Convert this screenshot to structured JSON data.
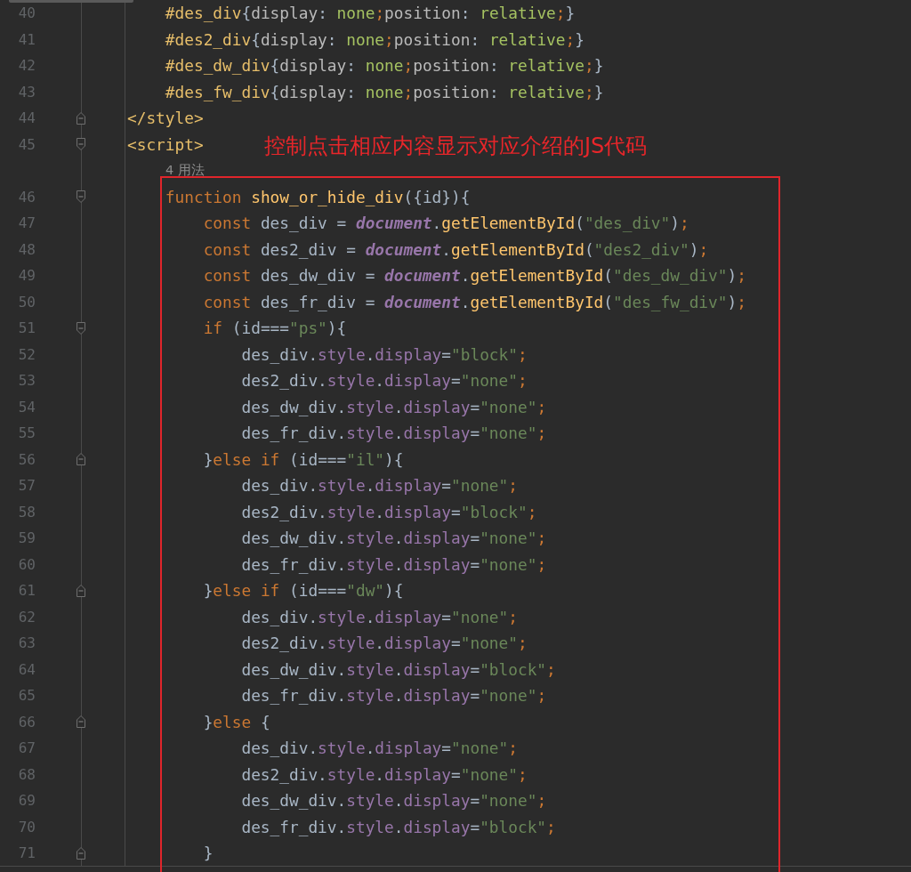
{
  "editor": {
    "lines": [
      {
        "kind": "code",
        "number": "40",
        "fold_open": false,
        "fold_close": false,
        "tokens": [
          {
            "kind": "selector",
            "text": "    #des_div"
          },
          {
            "kind": "plain",
            "text": "{"
          },
          {
            "kind": "css-property",
            "text": "display"
          },
          {
            "kind": "plain",
            "text": ": "
          },
          {
            "kind": "css-value",
            "text": "none"
          },
          {
            "kind": "punctuation",
            "text": ";"
          },
          {
            "kind": "css-property",
            "text": "position"
          },
          {
            "kind": "plain",
            "text": ": "
          },
          {
            "kind": "css-value",
            "text": "relative"
          },
          {
            "kind": "punctuation",
            "text": ";"
          },
          {
            "kind": "plain",
            "text": "}"
          }
        ]
      },
      {
        "kind": "code",
        "number": "41",
        "fold_open": false,
        "fold_close": false,
        "tokens": [
          {
            "kind": "selector",
            "text": "    #des2_div"
          },
          {
            "kind": "plain",
            "text": "{"
          },
          {
            "kind": "css-property",
            "text": "display"
          },
          {
            "kind": "plain",
            "text": ": "
          },
          {
            "kind": "css-value",
            "text": "none"
          },
          {
            "kind": "punctuation",
            "text": ";"
          },
          {
            "kind": "css-property",
            "text": "position"
          },
          {
            "kind": "plain",
            "text": ": "
          },
          {
            "kind": "css-value",
            "text": "relative"
          },
          {
            "kind": "punctuation",
            "text": ";"
          },
          {
            "kind": "plain",
            "text": "}"
          }
        ]
      },
      {
        "kind": "code",
        "number": "42",
        "fold_open": false,
        "fold_close": false,
        "tokens": [
          {
            "kind": "selector",
            "text": "    #des_dw_div"
          },
          {
            "kind": "plain",
            "text": "{"
          },
          {
            "kind": "css-property",
            "text": "display"
          },
          {
            "kind": "plain",
            "text": ": "
          },
          {
            "kind": "css-value",
            "text": "none"
          },
          {
            "kind": "punctuation",
            "text": ";"
          },
          {
            "kind": "css-property",
            "text": "position"
          },
          {
            "kind": "plain",
            "text": ": "
          },
          {
            "kind": "css-value",
            "text": "relative"
          },
          {
            "kind": "punctuation",
            "text": ";"
          },
          {
            "kind": "plain",
            "text": "}"
          }
        ]
      },
      {
        "kind": "code",
        "number": "43",
        "fold_open": false,
        "fold_close": false,
        "tokens": [
          {
            "kind": "selector",
            "text": "    #des_fw_div"
          },
          {
            "kind": "plain",
            "text": "{"
          },
          {
            "kind": "css-property",
            "text": "display"
          },
          {
            "kind": "plain",
            "text": ": "
          },
          {
            "kind": "css-value",
            "text": "none"
          },
          {
            "kind": "punctuation",
            "text": ";"
          },
          {
            "kind": "css-property",
            "text": "position"
          },
          {
            "kind": "plain",
            "text": ": "
          },
          {
            "kind": "css-value",
            "text": "relative"
          },
          {
            "kind": "punctuation",
            "text": ";"
          },
          {
            "kind": "plain",
            "text": "}"
          }
        ]
      },
      {
        "kind": "code",
        "number": "44",
        "fold_open": false,
        "fold_close": true,
        "tokens": [
          {
            "kind": "tag",
            "text": "</style>"
          }
        ]
      },
      {
        "kind": "code",
        "number": "45",
        "fold_open": true,
        "fold_close": false,
        "tokens": [
          {
            "kind": "tag",
            "text": "<script>"
          }
        ]
      },
      {
        "kind": "hint",
        "text": "4 用法"
      },
      {
        "kind": "code",
        "number": "46",
        "fold_open": true,
        "fold_close": false,
        "tokens": [
          {
            "kind": "keyword",
            "text": "    function "
          },
          {
            "kind": "function",
            "text": "show_or_hide_div"
          },
          {
            "kind": "plain",
            "text": "({id}){"
          }
        ]
      },
      {
        "kind": "code",
        "number": "47",
        "fold_open": false,
        "fold_close": false,
        "tokens": [
          {
            "kind": "keyword",
            "text": "        const "
          },
          {
            "kind": "plain",
            "text": "des_div = "
          },
          {
            "kind": "global",
            "text": "document"
          },
          {
            "kind": "plain",
            "text": "."
          },
          {
            "kind": "function",
            "text": "getElementById"
          },
          {
            "kind": "plain",
            "text": "("
          },
          {
            "kind": "string",
            "text": "\"des_div\""
          },
          {
            "kind": "plain",
            "text": ")"
          },
          {
            "kind": "punctuation",
            "text": ";"
          }
        ]
      },
      {
        "kind": "code",
        "number": "48",
        "fold_open": false,
        "fold_close": false,
        "tokens": [
          {
            "kind": "keyword",
            "text": "        const "
          },
          {
            "kind": "plain",
            "text": "des2_div = "
          },
          {
            "kind": "global",
            "text": "document"
          },
          {
            "kind": "plain",
            "text": "."
          },
          {
            "kind": "function",
            "text": "getElementById"
          },
          {
            "kind": "plain",
            "text": "("
          },
          {
            "kind": "string",
            "text": "\"des2_div\""
          },
          {
            "kind": "plain",
            "text": ")"
          },
          {
            "kind": "punctuation",
            "text": ";"
          }
        ]
      },
      {
        "kind": "code",
        "number": "49",
        "fold_open": false,
        "fold_close": false,
        "tokens": [
          {
            "kind": "keyword",
            "text": "        const "
          },
          {
            "kind": "plain",
            "text": "des_dw_div = "
          },
          {
            "kind": "global",
            "text": "document"
          },
          {
            "kind": "plain",
            "text": "."
          },
          {
            "kind": "function",
            "text": "getElementById"
          },
          {
            "kind": "plain",
            "text": "("
          },
          {
            "kind": "string",
            "text": "\"des_dw_div\""
          },
          {
            "kind": "plain",
            "text": ")"
          },
          {
            "kind": "punctuation",
            "text": ";"
          }
        ]
      },
      {
        "kind": "code",
        "number": "50",
        "fold_open": false,
        "fold_close": false,
        "tokens": [
          {
            "kind": "keyword",
            "text": "        const "
          },
          {
            "kind": "plain",
            "text": "des_fr_div = "
          },
          {
            "kind": "global",
            "text": "document"
          },
          {
            "kind": "plain",
            "text": "."
          },
          {
            "kind": "function",
            "text": "getElementById"
          },
          {
            "kind": "plain",
            "text": "("
          },
          {
            "kind": "string",
            "text": "\"des_fw_div\""
          },
          {
            "kind": "plain",
            "text": ")"
          },
          {
            "kind": "punctuation",
            "text": ";"
          }
        ]
      },
      {
        "kind": "code",
        "number": "51",
        "fold_open": true,
        "fold_close": false,
        "tokens": [
          {
            "kind": "keyword",
            "text": "        if "
          },
          {
            "kind": "plain",
            "text": "(id==="
          },
          {
            "kind": "string",
            "text": "\"ps\""
          },
          {
            "kind": "plain",
            "text": "){"
          }
        ]
      },
      {
        "kind": "code",
        "number": "52",
        "fold_open": false,
        "fold_close": false,
        "tokens": [
          {
            "kind": "plain",
            "text": "            des_div."
          },
          {
            "kind": "property",
            "text": "style"
          },
          {
            "kind": "plain",
            "text": "."
          },
          {
            "kind": "property",
            "text": "display"
          },
          {
            "kind": "plain",
            "text": "="
          },
          {
            "kind": "string",
            "text": "\"block\""
          },
          {
            "kind": "punctuation",
            "text": ";"
          }
        ]
      },
      {
        "kind": "code",
        "number": "53",
        "fold_open": false,
        "fold_close": false,
        "tokens": [
          {
            "kind": "plain",
            "text": "            des2_div."
          },
          {
            "kind": "property",
            "text": "style"
          },
          {
            "kind": "plain",
            "text": "."
          },
          {
            "kind": "property",
            "text": "display"
          },
          {
            "kind": "plain",
            "text": "="
          },
          {
            "kind": "string",
            "text": "\"none\""
          },
          {
            "kind": "punctuation",
            "text": ";"
          }
        ]
      },
      {
        "kind": "code",
        "number": "54",
        "fold_open": false,
        "fold_close": false,
        "tokens": [
          {
            "kind": "plain",
            "text": "            des_dw_div."
          },
          {
            "kind": "property",
            "text": "style"
          },
          {
            "kind": "plain",
            "text": "."
          },
          {
            "kind": "property",
            "text": "display"
          },
          {
            "kind": "plain",
            "text": "="
          },
          {
            "kind": "string",
            "text": "\"none\""
          },
          {
            "kind": "punctuation",
            "text": ";"
          }
        ]
      },
      {
        "kind": "code",
        "number": "55",
        "fold_open": false,
        "fold_close": false,
        "tokens": [
          {
            "kind": "plain",
            "text": "            des_fr_div."
          },
          {
            "kind": "property",
            "text": "style"
          },
          {
            "kind": "plain",
            "text": "."
          },
          {
            "kind": "property",
            "text": "display"
          },
          {
            "kind": "plain",
            "text": "="
          },
          {
            "kind": "string",
            "text": "\"none\""
          },
          {
            "kind": "punctuation",
            "text": ";"
          }
        ]
      },
      {
        "kind": "code",
        "number": "56",
        "fold_open": false,
        "fold_close": true,
        "tokens": [
          {
            "kind": "plain",
            "text": "        }"
          },
          {
            "kind": "keyword",
            "text": "else if "
          },
          {
            "kind": "plain",
            "text": "(id==="
          },
          {
            "kind": "string",
            "text": "\"il\""
          },
          {
            "kind": "plain",
            "text": "){"
          }
        ]
      },
      {
        "kind": "code",
        "number": "57",
        "fold_open": false,
        "fold_close": false,
        "tokens": [
          {
            "kind": "plain",
            "text": "            des_div."
          },
          {
            "kind": "property",
            "text": "style"
          },
          {
            "kind": "plain",
            "text": "."
          },
          {
            "kind": "property",
            "text": "display"
          },
          {
            "kind": "plain",
            "text": "="
          },
          {
            "kind": "string",
            "text": "\"none\""
          },
          {
            "kind": "punctuation",
            "text": ";"
          }
        ]
      },
      {
        "kind": "code",
        "number": "58",
        "fold_open": false,
        "fold_close": false,
        "tokens": [
          {
            "kind": "plain",
            "text": "            des2_div."
          },
          {
            "kind": "property",
            "text": "style"
          },
          {
            "kind": "plain",
            "text": "."
          },
          {
            "kind": "property",
            "text": "display"
          },
          {
            "kind": "plain",
            "text": "="
          },
          {
            "kind": "string",
            "text": "\"block\""
          },
          {
            "kind": "punctuation",
            "text": ";"
          }
        ]
      },
      {
        "kind": "code",
        "number": "59",
        "fold_open": false,
        "fold_close": false,
        "tokens": [
          {
            "kind": "plain",
            "text": "            des_dw_div."
          },
          {
            "kind": "property",
            "text": "style"
          },
          {
            "kind": "plain",
            "text": "."
          },
          {
            "kind": "property",
            "text": "display"
          },
          {
            "kind": "plain",
            "text": "="
          },
          {
            "kind": "string",
            "text": "\"none\""
          },
          {
            "kind": "punctuation",
            "text": ";"
          }
        ]
      },
      {
        "kind": "code",
        "number": "60",
        "fold_open": false,
        "fold_close": false,
        "tokens": [
          {
            "kind": "plain",
            "text": "            des_fr_div."
          },
          {
            "kind": "property",
            "text": "style"
          },
          {
            "kind": "plain",
            "text": "."
          },
          {
            "kind": "property",
            "text": "display"
          },
          {
            "kind": "plain",
            "text": "="
          },
          {
            "kind": "string",
            "text": "\"none\""
          },
          {
            "kind": "punctuation",
            "text": ";"
          }
        ]
      },
      {
        "kind": "code",
        "number": "61",
        "fold_open": false,
        "fold_close": true,
        "tokens": [
          {
            "kind": "plain",
            "text": "        }"
          },
          {
            "kind": "keyword",
            "text": "else if "
          },
          {
            "kind": "plain",
            "text": "(id==="
          },
          {
            "kind": "string",
            "text": "\"dw\""
          },
          {
            "kind": "plain",
            "text": "){"
          }
        ]
      },
      {
        "kind": "code",
        "number": "62",
        "fold_open": false,
        "fold_close": false,
        "tokens": [
          {
            "kind": "plain",
            "text": "            des_div."
          },
          {
            "kind": "property",
            "text": "style"
          },
          {
            "kind": "plain",
            "text": "."
          },
          {
            "kind": "property",
            "text": "display"
          },
          {
            "kind": "plain",
            "text": "="
          },
          {
            "kind": "string",
            "text": "\"none\""
          },
          {
            "kind": "punctuation",
            "text": ";"
          }
        ]
      },
      {
        "kind": "code",
        "number": "63",
        "fold_open": false,
        "fold_close": false,
        "tokens": [
          {
            "kind": "plain",
            "text": "            des2_div."
          },
          {
            "kind": "property",
            "text": "style"
          },
          {
            "kind": "plain",
            "text": "."
          },
          {
            "kind": "property",
            "text": "display"
          },
          {
            "kind": "plain",
            "text": "="
          },
          {
            "kind": "string",
            "text": "\"none\""
          },
          {
            "kind": "punctuation",
            "text": ";"
          }
        ]
      },
      {
        "kind": "code",
        "number": "64",
        "fold_open": false,
        "fold_close": false,
        "tokens": [
          {
            "kind": "plain",
            "text": "            des_dw_div."
          },
          {
            "kind": "property",
            "text": "style"
          },
          {
            "kind": "plain",
            "text": "."
          },
          {
            "kind": "property",
            "text": "display"
          },
          {
            "kind": "plain",
            "text": "="
          },
          {
            "kind": "string",
            "text": "\"block\""
          },
          {
            "kind": "punctuation",
            "text": ";"
          }
        ]
      },
      {
        "kind": "code",
        "number": "65",
        "fold_open": false,
        "fold_close": false,
        "tokens": [
          {
            "kind": "plain",
            "text": "            des_fr_div."
          },
          {
            "kind": "property",
            "text": "style"
          },
          {
            "kind": "plain",
            "text": "."
          },
          {
            "kind": "property",
            "text": "display"
          },
          {
            "kind": "plain",
            "text": "="
          },
          {
            "kind": "string",
            "text": "\"none\""
          },
          {
            "kind": "punctuation",
            "text": ";"
          }
        ]
      },
      {
        "kind": "code",
        "number": "66",
        "fold_open": false,
        "fold_close": true,
        "tokens": [
          {
            "kind": "plain",
            "text": "        }"
          },
          {
            "kind": "keyword",
            "text": "else "
          },
          {
            "kind": "plain",
            "text": "{"
          }
        ]
      },
      {
        "kind": "code",
        "number": "67",
        "fold_open": false,
        "fold_close": false,
        "tokens": [
          {
            "kind": "plain",
            "text": "            des_div."
          },
          {
            "kind": "property",
            "text": "style"
          },
          {
            "kind": "plain",
            "text": "."
          },
          {
            "kind": "property",
            "text": "display"
          },
          {
            "kind": "plain",
            "text": "="
          },
          {
            "kind": "string",
            "text": "\"none\""
          },
          {
            "kind": "punctuation",
            "text": ";"
          }
        ]
      },
      {
        "kind": "code",
        "number": "68",
        "fold_open": false,
        "fold_close": false,
        "tokens": [
          {
            "kind": "plain",
            "text": "            des2_div."
          },
          {
            "kind": "property",
            "text": "style"
          },
          {
            "kind": "plain",
            "text": "."
          },
          {
            "kind": "property",
            "text": "display"
          },
          {
            "kind": "plain",
            "text": "="
          },
          {
            "kind": "string",
            "text": "\"none\""
          },
          {
            "kind": "punctuation",
            "text": ";"
          }
        ]
      },
      {
        "kind": "code",
        "number": "69",
        "fold_open": false,
        "fold_close": false,
        "tokens": [
          {
            "kind": "plain",
            "text": "            des_dw_div."
          },
          {
            "kind": "property",
            "text": "style"
          },
          {
            "kind": "plain",
            "text": "."
          },
          {
            "kind": "property",
            "text": "display"
          },
          {
            "kind": "plain",
            "text": "="
          },
          {
            "kind": "string",
            "text": "\"none\""
          },
          {
            "kind": "punctuation",
            "text": ";"
          }
        ]
      },
      {
        "kind": "code",
        "number": "70",
        "fold_open": false,
        "fold_close": false,
        "tokens": [
          {
            "kind": "plain",
            "text": "            des_fr_div."
          },
          {
            "kind": "property",
            "text": "style"
          },
          {
            "kind": "plain",
            "text": "."
          },
          {
            "kind": "property",
            "text": "display"
          },
          {
            "kind": "plain",
            "text": "="
          },
          {
            "kind": "string",
            "text": "\"block\""
          },
          {
            "kind": "punctuation",
            "text": ";"
          }
        ]
      },
      {
        "kind": "code",
        "number": "71",
        "fold_open": false,
        "fold_close": true,
        "tokens": [
          {
            "kind": "plain",
            "text": "        }"
          }
        ]
      }
    ]
  },
  "annotation": {
    "text": "控制点击相应内容显示对应介绍的JS代码"
  }
}
